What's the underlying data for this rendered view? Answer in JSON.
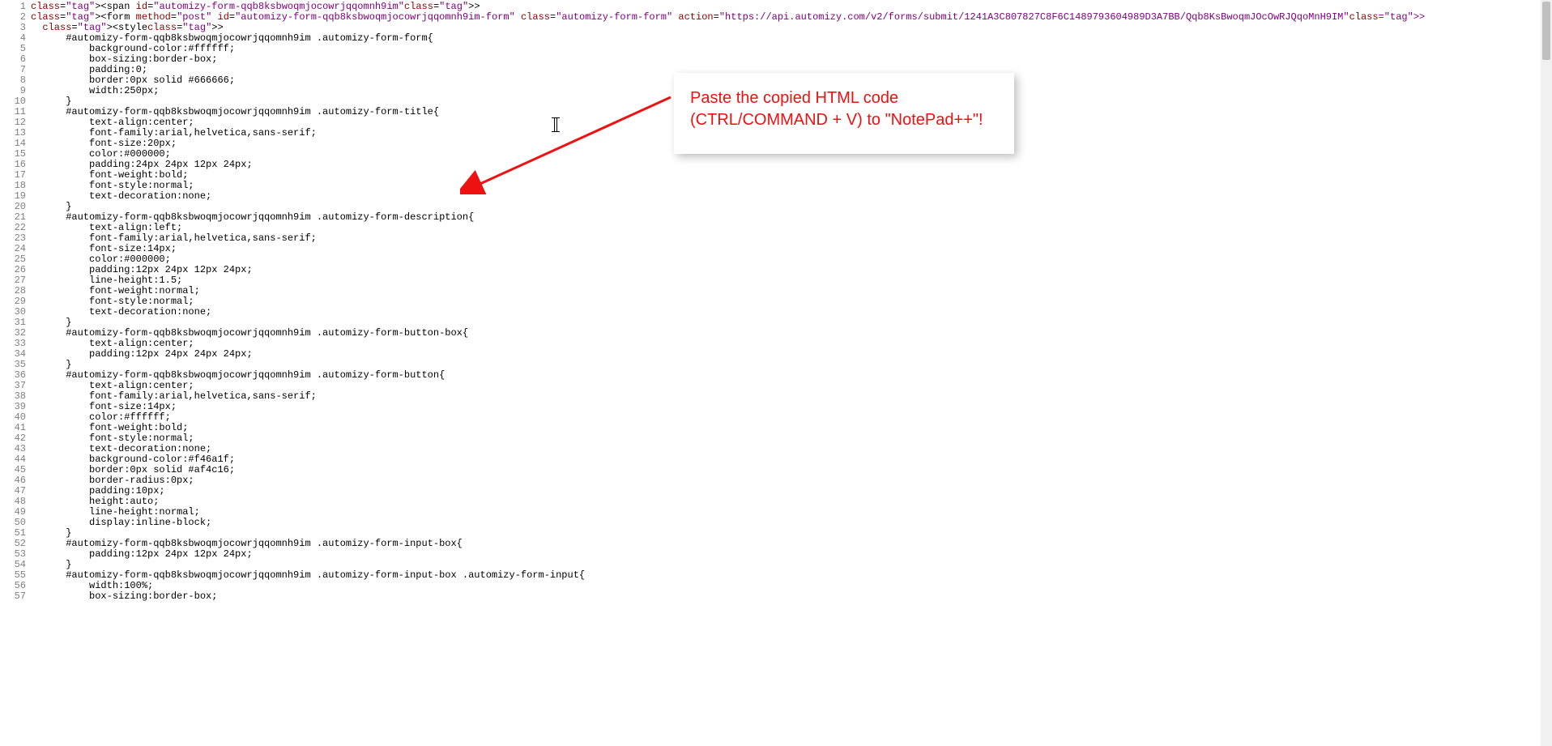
{
  "callout": {
    "line1": "Paste the copied HTML code",
    "line2": "(CTRL/COMMAND + V) to \"NotePad++\"!"
  },
  "form_id": "automizy-form-qqb8ksbwoqmjocowrjqqomnh9im",
  "form_action": "https://api.automizy.com/v2/forms/submit/1241A3C807827C8F6C1489793604989D3A7BB/Qqb8KsBwoqmJOcOwRJQqoMnH9IM",
  "code_lines": [
    "<span id=\"automizy-form-qqb8ksbwoqmjocowrjqqomnh9im\">",
    "<form method=\"post\" id=\"automizy-form-qqb8ksbwoqmjocowrjqqomnh9im-form\" class=\"automizy-form-form\" action=\"https://api.automizy.com/v2/forms/submit/1241A3C807827C8F6C1489793604989D3A7BB/Qqb8KsBwoqmJOcOwRJQqoMnH9IM\">",
    "  <style>",
    "      #automizy-form-qqb8ksbwoqmjocowrjqqomnh9im .automizy-form-form{",
    "          background-color:#ffffff;",
    "          box-sizing:border-box;",
    "          padding:0;",
    "          border:0px solid #666666;",
    "          width:250px;",
    "      }",
    "      #automizy-form-qqb8ksbwoqmjocowrjqqomnh9im .automizy-form-title{",
    "          text-align:center;",
    "          font-family:arial,helvetica,sans-serif;",
    "          font-size:20px;",
    "          color:#000000;",
    "          padding:24px 24px 12px 24px;",
    "          font-weight:bold;",
    "          font-style:normal;",
    "          text-decoration:none;",
    "      }",
    "      #automizy-form-qqb8ksbwoqmjocowrjqqomnh9im .automizy-form-description{",
    "          text-align:left;",
    "          font-family:arial,helvetica,sans-serif;",
    "          font-size:14px;",
    "          color:#000000;",
    "          padding:12px 24px 12px 24px;",
    "          line-height:1.5;",
    "          font-weight:normal;",
    "          font-style:normal;",
    "          text-decoration:none;",
    "      }",
    "      #automizy-form-qqb8ksbwoqmjocowrjqqomnh9im .automizy-form-button-box{",
    "          text-align:center;",
    "          padding:12px 24px 24px 24px;",
    "      }",
    "      #automizy-form-qqb8ksbwoqmjocowrjqqomnh9im .automizy-form-button{",
    "          text-align:center;",
    "          font-family:arial,helvetica,sans-serif;",
    "          font-size:14px;",
    "          color:#ffffff;",
    "          font-weight:bold;",
    "          font-style:normal;",
    "          text-decoration:none;",
    "          background-color:#f46a1f;",
    "          border:0px solid #af4c16;",
    "          border-radius:0px;",
    "          padding:10px;",
    "          height:auto;",
    "          line-height:normal;",
    "          display:inline-block;",
    "      }",
    "      #automizy-form-qqb8ksbwoqmjocowrjqqomnh9im .automizy-form-input-box{",
    "          padding:12px 24px 12px 24px;",
    "      }",
    "      #automizy-form-qqb8ksbwoqmjocowrjqqomnh9im .automizy-form-input-box .automizy-form-input{",
    "          width:100%;",
    "          box-sizing:border-box;"
  ]
}
